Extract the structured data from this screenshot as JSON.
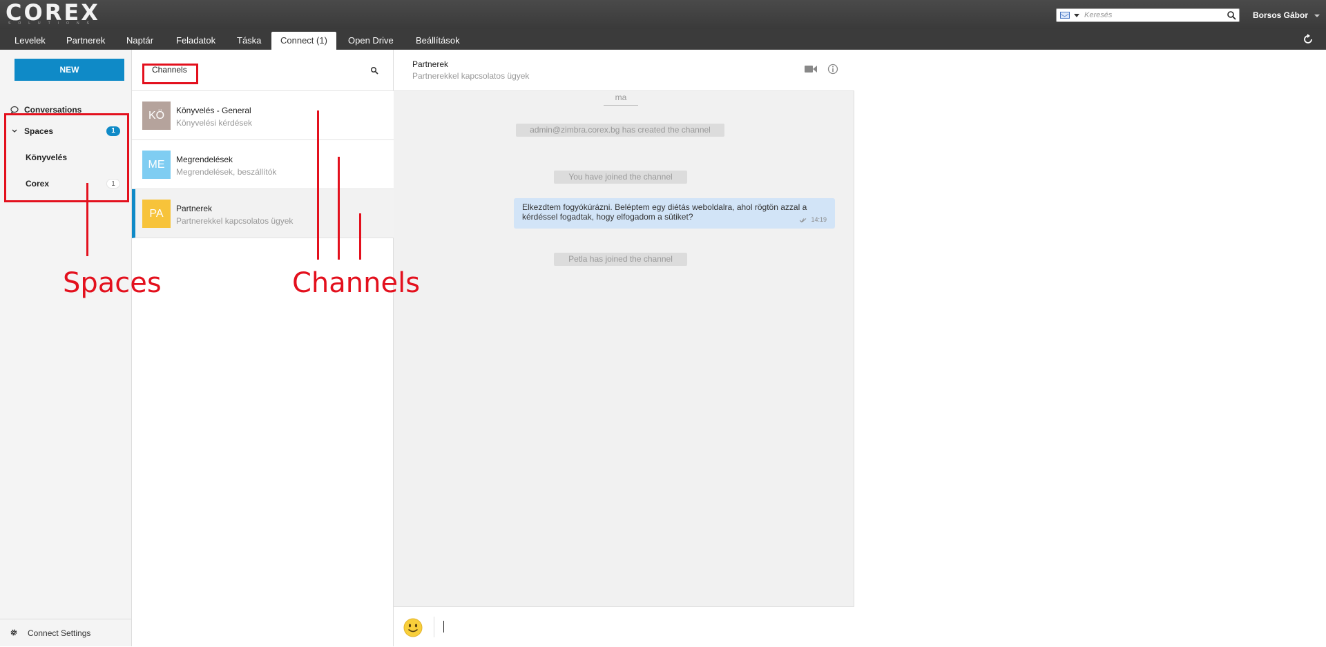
{
  "brand": {
    "logo": "COREX",
    "logo_sub": "SOLUTIONS"
  },
  "topbar": {
    "search_placeholder": "Keresés",
    "user_name": "Borsos Gábor"
  },
  "tabs": [
    {
      "label": "Levelek"
    },
    {
      "label": "Partnerek"
    },
    {
      "label": "Naptár"
    },
    {
      "label": "Feladatok"
    },
    {
      "label": "Táska"
    },
    {
      "label": "Connect (1)",
      "active": true
    },
    {
      "label": "Open Drive"
    },
    {
      "label": "Beállítások"
    }
  ],
  "leftnav": {
    "new_label": "NEW",
    "conversations_label": "Conversations",
    "spaces_label": "Spaces",
    "spaces_badge": "1",
    "spaces": [
      {
        "label": "Könyvelés",
        "badge": ""
      },
      {
        "label": "Corex",
        "badge": "1"
      }
    ],
    "settings_label": "Connect Settings"
  },
  "channels": {
    "title": "Channels",
    "items": [
      {
        "initials": "KÖ",
        "name": "Könyvelés - General",
        "description": "Könyvelési kérdések",
        "avatar_color": "#b5a39c"
      },
      {
        "initials": "ME",
        "name": "Megrendelések",
        "description": "Megrendelések, beszállítók",
        "avatar_color": "#7fcdf2"
      },
      {
        "initials": "PA",
        "name": "Partnerek",
        "description": "Partnerekkel kapcsolatos ügyek",
        "avatar_color": "#f7c33a",
        "selected": true
      }
    ]
  },
  "chat": {
    "title": "Partnerek",
    "subtitle": "Partnerekkel kapcsolatos ügyek",
    "date_separator": "ma",
    "system_messages": [
      "admin@zimbra.corex.bg has created the channel",
      "You have joined the channel",
      "Petla has joined the channel"
    ],
    "message": {
      "text": "Elkezdtem fogyókúrázni. Beléptem egy diétás weboldalra, ahol rögtön azzal a kérdéssel fogadtak, hogy elfogadom a sütiket?",
      "time": "14:19"
    },
    "input_value": ""
  },
  "annotations": {
    "spaces_label": "Spaces",
    "channels_label": "Channels",
    "color": "#e3101d"
  }
}
